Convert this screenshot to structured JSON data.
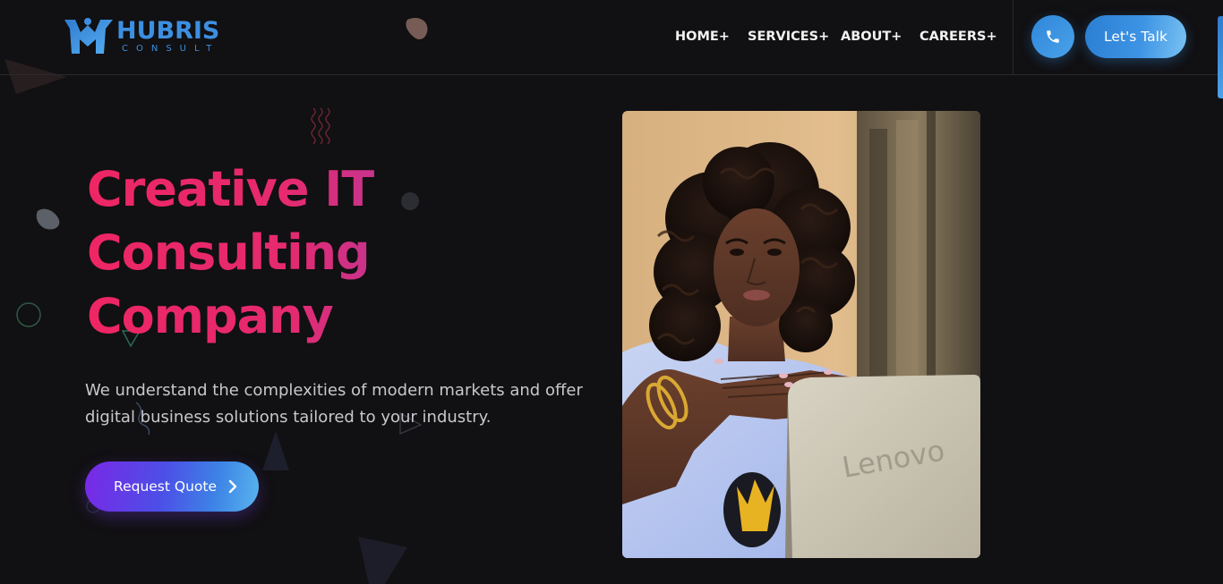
{
  "brand": {
    "name": "HUBRIS",
    "tagline": "CONSULT"
  },
  "nav": {
    "items": [
      {
        "label": "HOME+"
      },
      {
        "label": "SERVICES+"
      },
      {
        "label": "ABOUT+"
      },
      {
        "label": "CAREERS+"
      }
    ]
  },
  "header_actions": {
    "phone_icon": "phone-icon",
    "talk_label": "Let's Talk"
  },
  "hero": {
    "title_lines": [
      "Creative IT",
      "Consulting",
      "Company"
    ],
    "description": "We understand the complexities of modern markets and offer digital business solutions tailored to your industry.",
    "cta_label": "Request Quote",
    "cta_icon": "chevron-right-icon",
    "photo_alt": "Woman with curly hair sitting behind a Lenovo laptop",
    "laptop_brand": "Lenovo"
  },
  "colors": {
    "background": "#111012",
    "accent_blue": "#3d8fe0",
    "title_pink": "#ee2664",
    "title_purple": "#7b41c4",
    "cta_purple": "#7a28e6",
    "cta_blue": "#59b5ee"
  }
}
